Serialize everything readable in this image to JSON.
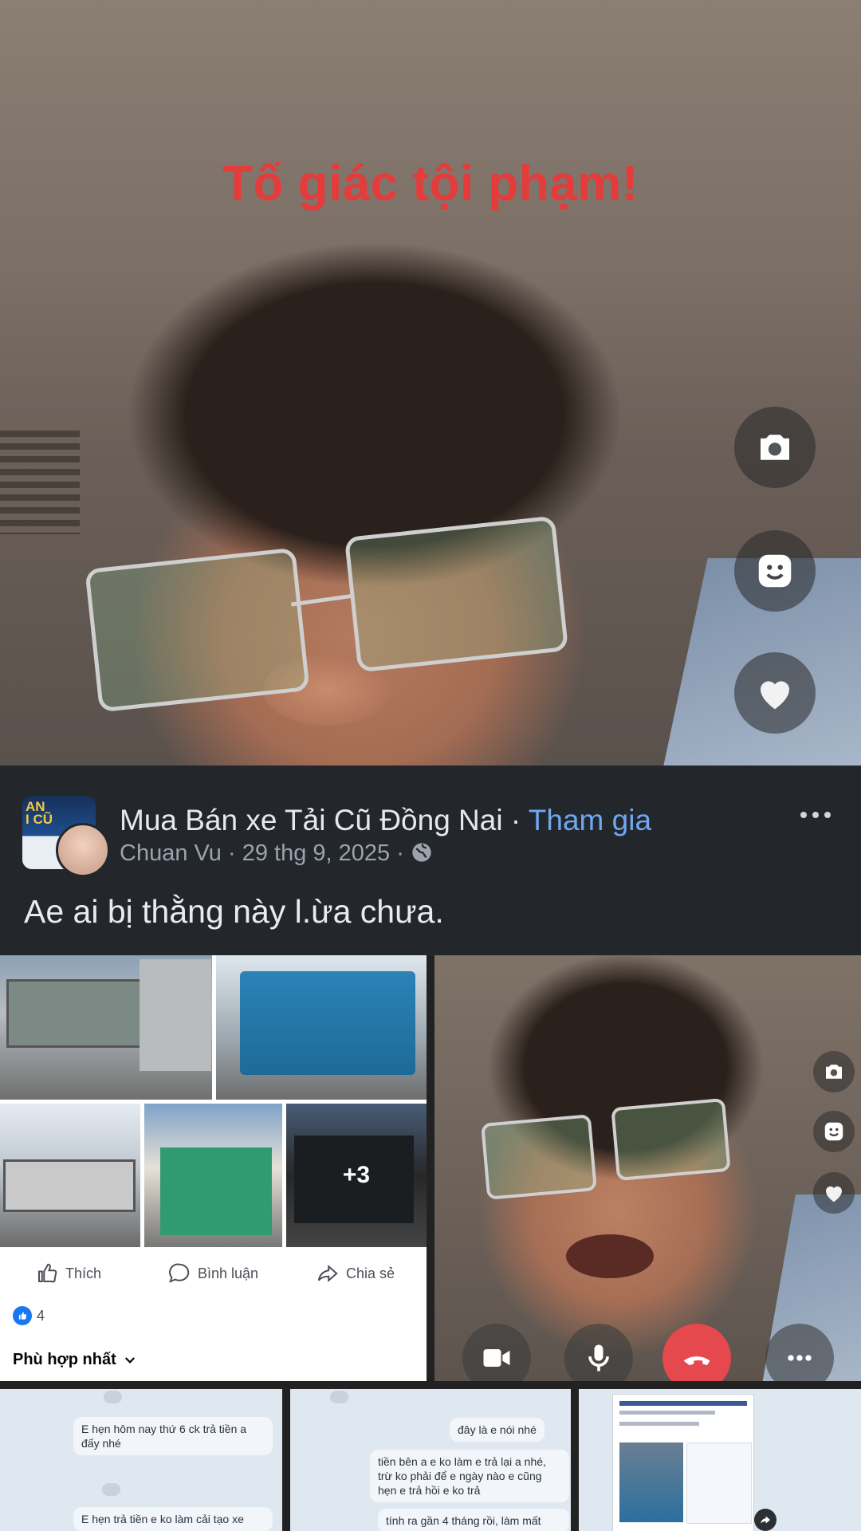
{
  "overlay": {
    "title": "Tố giác tội phạm!"
  },
  "side_buttons": {
    "camera": "camera-icon",
    "face": "smile-icon",
    "heart": "heart-icon"
  },
  "post": {
    "group_name": "Mua Bán xe Tải Cũ Đồng Nai",
    "separator": " · ",
    "join_label": "Tham gia",
    "author": "Chuan Vu",
    "date": "29 thg 9, 2025",
    "meta_sep": " · ",
    "avatar_text": "AN\nI CŨ",
    "text": "Ae ai bị thằng này l.ừa chưa.",
    "more_photos": "+3"
  },
  "actions": {
    "like": "Thích",
    "comment": "Bình luận",
    "share": "Chia sẻ",
    "reaction_count": "4",
    "sort_label": "Phù hợp nhất"
  },
  "call_controls": [
    "video-icon",
    "mic-icon",
    "end-call-icon",
    "more-icon"
  ],
  "chat1": {
    "bubble1": "E hẹn hôm nay thứ 6 ck trả tiền a đấy nhé",
    "bubble2": "E hẹn trả tiền e ko làm cải tạo xe"
  },
  "chat2": {
    "bubble1": "đây là e nói nhé",
    "bubble2": "tiền bên a e ko làm e trả lại a nhé, trừ ko phải để e ngày nào e cũng hẹn e trả hồi e ko trả",
    "bubble3": "tính ra gần 4 tháng rồi, làm mất"
  },
  "colors": {
    "overlay_red": "#e53b3b",
    "fb_dark": "#23272c",
    "fb_blue": "#1877f2",
    "join_blue": "#6ea8f0",
    "end_call": "#e5484d"
  }
}
